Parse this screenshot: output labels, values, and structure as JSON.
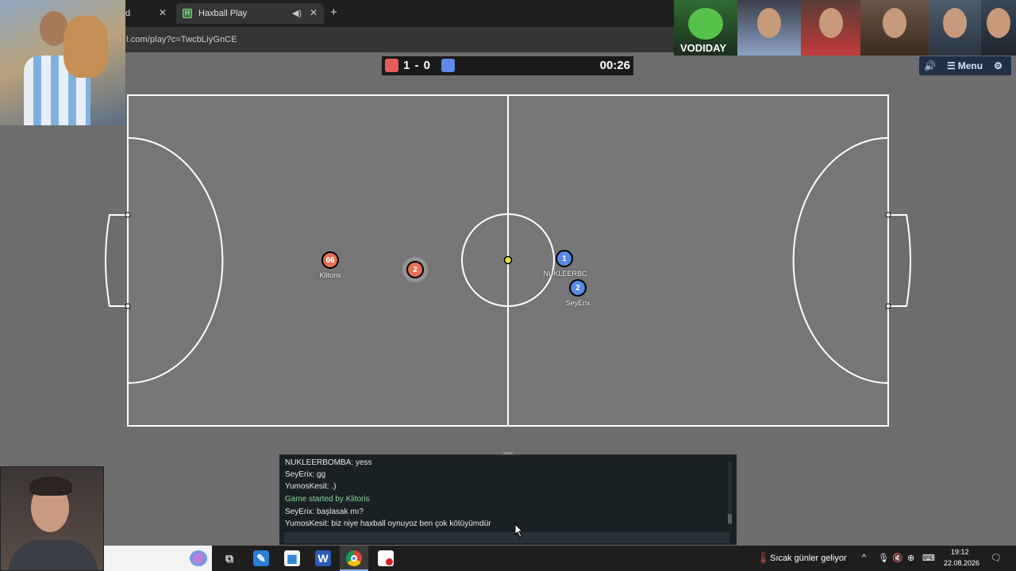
{
  "browser": {
    "tabs": [
      {
        "label": "d",
        "active": false
      },
      {
        "label": "Haxball Play",
        "active": true,
        "favicon": "haxball-icon",
        "audio": "speaker-icon"
      }
    ],
    "new_tab_symbol": "+",
    "close_symbol": "✕",
    "url": "l.com/play?c=TwcbLiyGnCE"
  },
  "stream": {
    "overlay_label": "VODIDAY"
  },
  "game": {
    "score_text": "1 - 0",
    "red_score": 1,
    "blue_score": 0,
    "timer": "00:26",
    "team_colors": {
      "red": "#e56e56",
      "blue": "#5689e5"
    },
    "hud": {
      "sound_icon": "speaker-icon",
      "menu_icon": "menu-icon",
      "menu_label": "Menu",
      "settings_icon": "gear-icon"
    },
    "players": [
      {
        "number": "66",
        "name": "Klitoris",
        "team": "red"
      },
      {
        "number": "2",
        "name": "",
        "team": "red",
        "controlled": true
      },
      {
        "number": "1",
        "name": "NUKLEERBC",
        "team": "blue"
      },
      {
        "number": "2",
        "name": "SeyErix",
        "team": "blue"
      }
    ],
    "ball_color": "#e6e22f",
    "field_colors": {
      "grass": "#767676",
      "lines": "#ffffff"
    }
  },
  "chat": {
    "lines": [
      {
        "text": "NUKLEERBOMBA: yess",
        "system": false
      },
      {
        "text": "SeyErix: gg",
        "system": false
      },
      {
        "text": "YumosKesit: .)",
        "system": false
      },
      {
        "text": "Game started by Klitoris",
        "system": true
      },
      {
        "text": "SeyErix: başlasak mı?",
        "system": false
      },
      {
        "text": "YumosKesit: biz niye haxball oynuyoz ben çok kötüyümdür",
        "system": false
      }
    ],
    "input_value": ""
  },
  "taskbar": {
    "weather_text": "Sıcak günler geliyor",
    "time": "19:12",
    "date": "22.08.2026",
    "apps": [
      "task-view-icon",
      "snip-icon",
      "store-icon",
      "word-icon",
      "chrome-icon",
      "pdf-icon"
    ]
  }
}
